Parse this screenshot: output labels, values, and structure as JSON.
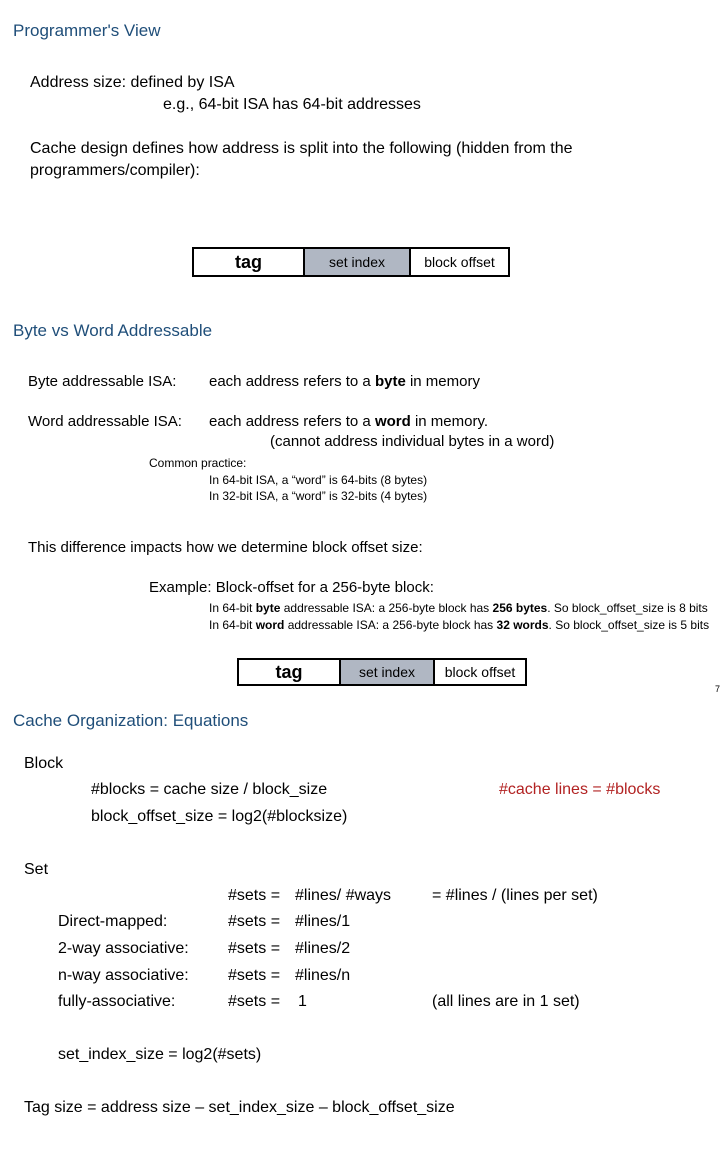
{
  "section1": {
    "heading": "Programmer's View",
    "address_size": "Address size: defined by ISA",
    "address_example": "e.g., 64-bit ISA has 64-bit addresses",
    "cache_design_line1": "Cache design defines how address is split into the following (hidden from the",
    "cache_design_line2": "programmers/compiler):"
  },
  "address_bar": {
    "tag": "tag",
    "set_index": "set index",
    "block_offset": "block offset"
  },
  "section2": {
    "heading": "Byte vs Word Addressable",
    "byte_label": "Byte addressable ISA:",
    "byte_desc_pre": "each address refers to a ",
    "byte_desc_bold": "byte",
    "byte_desc_post": " in memory",
    "word_label": "Word addressable ISA:",
    "word_desc_pre": "each address refers to a ",
    "word_desc_bold": "word",
    "word_desc_post": " in memory.",
    "word_note": "(cannot address individual bytes in a word)",
    "common_practice": "Common practice:",
    "practice_64": "In 64-bit ISA, a “word” is 64-bits (8 bytes)",
    "practice_32": "In 32-bit ISA, a “word” is 32-bits (4 bytes)",
    "impact": "This difference impacts how we determine block offset size:",
    "example": "Example: Block-offset for a 256-byte block:",
    "ex1_a": "In 64-bit ",
    "ex1_b": "byte",
    "ex1_c": " addressable ISA:   a 256-byte block has ",
    "ex1_d": "256 bytes",
    "ex1_e": ". So block_offset_size is 8 bits",
    "ex2_a": "In 64-bit ",
    "ex2_b": "word",
    "ex2_c": " addressable ISA: a 256-byte block has  ",
    "ex2_d": "32 words",
    "ex2_e": ". So block_offset_size is 5 bits",
    "page_number": "7"
  },
  "section3": {
    "heading": "Cache Organization: Equations",
    "block_label": "Block",
    "blocks_eq": "#blocks = cache size / block_size",
    "cache_lines_eq": "#cache lines = #blocks",
    "block_offset_eq": "block_offset_size = log2(#blocksize)",
    "set_label": "Set",
    "sets_prefix": "#sets =",
    "rows": [
      {
        "label": "",
        "value": "#lines/ #ways",
        "note": "= #lines / (lines per set)"
      },
      {
        "label": "Direct-mapped:",
        "value": "#lines/1",
        "note": ""
      },
      {
        "label": "2-way associative:",
        "value": "#lines/2",
        "note": ""
      },
      {
        "label": "n-way associative:",
        "value": "#lines/n",
        "note": ""
      },
      {
        "label": "fully-associative:",
        "value": "1",
        "note": "(all lines are in 1 set)"
      }
    ],
    "set_index_eq": "set_index_size = log2(#sets)",
    "tag_size_eq": "Tag size = address size – set_index_size – block_offset_size"
  },
  "colors": {
    "heading": "#1f4e79",
    "red": "#b22222",
    "set_index_fill": "#b0b7c3"
  }
}
